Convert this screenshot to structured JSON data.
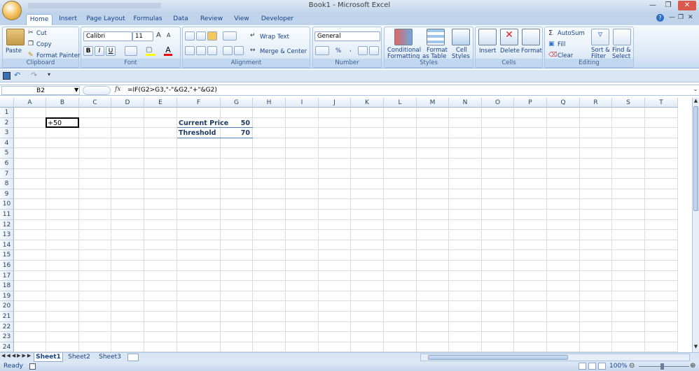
{
  "window": {
    "title": "Book1 - Microsoft Excel"
  },
  "tabs": [
    "Home",
    "Insert",
    "Page Layout",
    "Formulas",
    "Data",
    "Review",
    "View",
    "Developer"
  ],
  "ribbon": {
    "clipboard": {
      "label": "Clipboard",
      "paste": "Paste",
      "cut": "Cut",
      "copy": "Copy",
      "format_painter": "Format Painter"
    },
    "font": {
      "label": "Font",
      "name": "Calibri",
      "size": "11",
      "bold": "B",
      "italic": "I",
      "underline": "U"
    },
    "alignment": {
      "label": "Alignment",
      "wrap_text": "Wrap Text",
      "merge_center": "Merge & Center"
    },
    "number": {
      "label": "Number",
      "format": "General",
      "percent": "%",
      "comma": ","
    },
    "styles": {
      "label": "Styles",
      "conditional": "Conditional",
      "conditional2": "Formatting",
      "format_table": "Format",
      "format_table2": "as Table",
      "cell_styles": "Cell",
      "cell_styles2": "Styles"
    },
    "cells": {
      "label": "Cells",
      "insert": "Insert",
      "delete": "Delete",
      "format": "Format"
    },
    "editing": {
      "label": "Editing",
      "autosum": "AutoSum",
      "fill": "Fill",
      "clear": "Clear",
      "sort": "Sort &",
      "sort2": "Filter",
      "find": "Find &",
      "find2": "Select"
    }
  },
  "formula_bar": {
    "name_box": "B2",
    "fx": "fx",
    "formula": "=IF(G2>G3,\"-\"&G2,\"+\"&G2)"
  },
  "grid": {
    "columns": [
      "A",
      "B",
      "C",
      "D",
      "E",
      "F",
      "G",
      "H",
      "I",
      "J",
      "K",
      "L",
      "M",
      "N",
      "O",
      "P",
      "Q",
      "R",
      "S",
      "T"
    ],
    "rows": [
      "1",
      "2",
      "3",
      "4",
      "5",
      "6",
      "7",
      "8",
      "9",
      "10",
      "11",
      "12",
      "13",
      "14",
      "15",
      "16",
      "17",
      "18",
      "19",
      "20",
      "21",
      "22",
      "23",
      "24"
    ],
    "cells": {
      "B2": "+50",
      "F2": "Current Price",
      "G2": "50",
      "F3": "Threshold",
      "G3": "70"
    }
  },
  "sheets": [
    "Sheet1",
    "Sheet2",
    "Sheet3"
  ],
  "status": {
    "ready": "Ready",
    "zoom": "100%"
  },
  "colors": {
    "accent": "#15428b",
    "ribbon": "#dbe6f4"
  }
}
